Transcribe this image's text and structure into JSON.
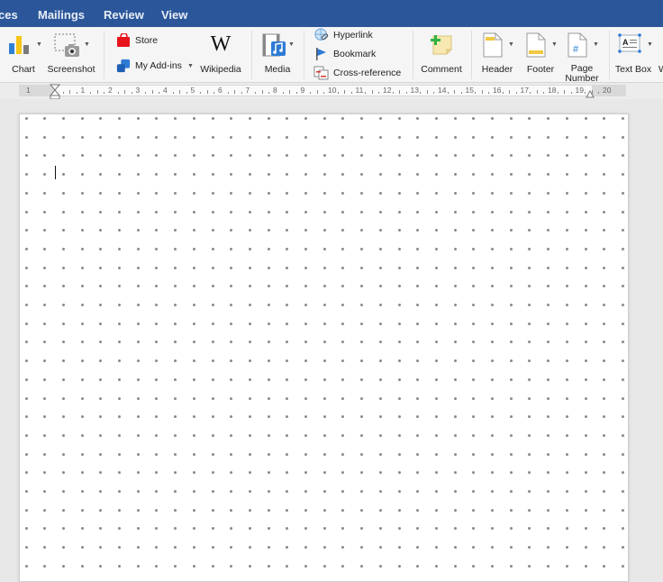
{
  "tabs": [
    {
      "label": "ces",
      "active": false
    },
    {
      "label": "Mailings",
      "active": false
    },
    {
      "label": "Review",
      "active": false
    },
    {
      "label": "View",
      "active": false
    }
  ],
  "ribbon": {
    "chart": {
      "label": "Chart",
      "icon": "chart-icon"
    },
    "screenshot": {
      "label": "Screenshot",
      "icon": "screenshot-icon"
    },
    "store": {
      "label": "Store",
      "icon": "store-icon"
    },
    "addins": {
      "label": "My Add-ins",
      "icon": "addins-icon"
    },
    "wikipedia": {
      "label": "Wikipedia",
      "glyph": "W",
      "icon": "wikipedia-icon"
    },
    "media": {
      "label": "Media",
      "icon": "media-icon"
    },
    "hyperlink": {
      "label": "Hyperlink",
      "icon": "hyperlink-icon"
    },
    "bookmark": {
      "label": "Bookmark",
      "icon": "bookmark-icon"
    },
    "crossref": {
      "label": "Cross-reference",
      "icon": "cross-reference-icon"
    },
    "comment": {
      "label": "Comment",
      "icon": "comment-icon"
    },
    "header": {
      "label": "Header",
      "icon": "header-icon"
    },
    "footer": {
      "label": "Footer",
      "icon": "footer-icon"
    },
    "pagenum": {
      "label_line1": "Page",
      "label_line2": "Number",
      "glyph": "#",
      "icon": "page-number-icon"
    },
    "textbox": {
      "label": "Text Box",
      "glyph": "A",
      "icon": "text-box-icon"
    },
    "cutoff": {
      "label": "W"
    }
  },
  "ruler": {
    "numbers": [
      "1",
      "1",
      "2",
      "3",
      "4",
      "5",
      "6",
      "7",
      "8",
      "9",
      "10",
      "11",
      "12",
      "13",
      "14",
      "15",
      "16",
      "17",
      "18",
      "19",
      "20"
    ]
  },
  "colors": {
    "tabbar": "#2b579a",
    "store_red": "#e8141b",
    "addins_blue": "#2e7bd6",
    "chart_blue": "#2f80d6",
    "chart_yellow": "#f5c518",
    "chart_gray": "#7a7a7a",
    "comment_green": "#2fb344",
    "accent_yellow": "#f2c842"
  },
  "document": {
    "grid_style": "dot grid",
    "cursor_visible": true
  }
}
